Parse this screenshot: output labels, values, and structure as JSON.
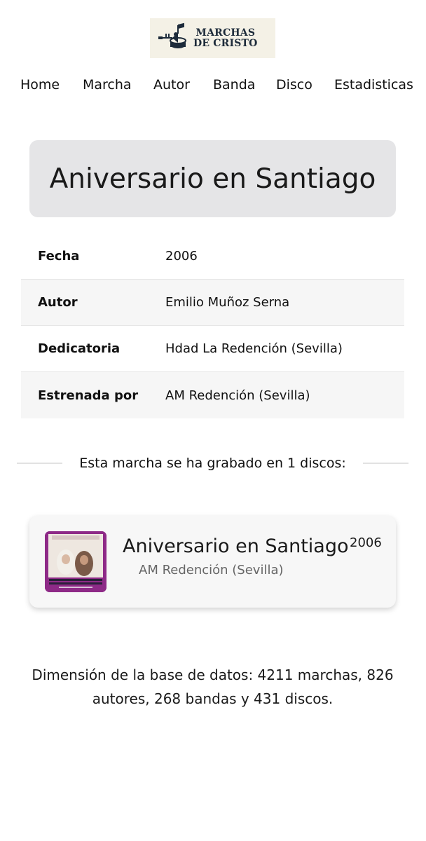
{
  "logo": {
    "line1": "MARCHAS",
    "line2": "DE CRISTO",
    "icon": "trumpet-drum-music-note-icon"
  },
  "nav": {
    "items": [
      {
        "label": "Home"
      },
      {
        "label": "Marcha"
      },
      {
        "label": "Autor"
      },
      {
        "label": "Banda"
      },
      {
        "label": "Disco"
      },
      {
        "label": "Estadisticas"
      }
    ]
  },
  "march": {
    "title": "Aniversario en Santiago",
    "details": [
      {
        "label": "Fecha",
        "value": "2006"
      },
      {
        "label": "Autor",
        "value": "Emilio Muñoz Serna"
      },
      {
        "label": "Dedicatoria",
        "value": "Hdad La Redención (Sevilla)"
      },
      {
        "label": "Estrenada por",
        "value": "AM Redención (Sevilla)"
      }
    ]
  },
  "recordings": {
    "heading": "Esta marcha se ha grabado en 1 discos:",
    "discs": [
      {
        "title": "Aniversario en Santiago",
        "band": "AM Redención (Sevilla)",
        "year": "2006"
      }
    ]
  },
  "stats": {
    "text": "Dimensión de la base de datos: 4211 marchas, 826 autores, 268 bandas y 431 discos."
  },
  "colors": {
    "title_box_bg": "#e5e5e7",
    "logo_bg": "#f4f1e6",
    "logo_text": "#1d2b3a",
    "disc_cover": "#8e2a87"
  }
}
